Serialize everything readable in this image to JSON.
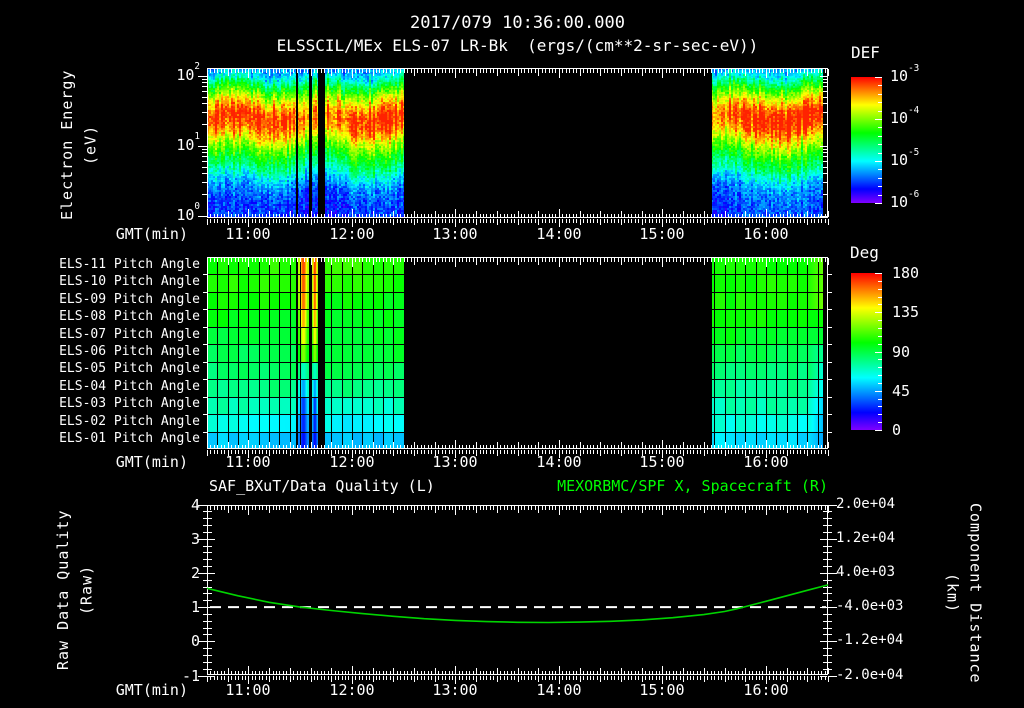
{
  "header": {
    "datetime": "2017/079 10:36:00.000",
    "title": "ELSSCIL/MEx ELS-07 LR-Bk  (ergs/(cm**2-sr-sec-eV))"
  },
  "time_axis": {
    "label": "GMT(min)",
    "start_hour": 10.6,
    "end_hour": 16.6,
    "tick_hours": [
      11,
      12,
      13,
      14,
      15,
      16
    ],
    "tick_labels": [
      "11:00",
      "12:00",
      "13:00",
      "14:00",
      "15:00",
      "16:00"
    ],
    "minor_step_min": 2,
    "medium_step_min": 12
  },
  "colors": {
    "background": "#000000",
    "foreground": "#ffffff",
    "accent_green": "#00ff00",
    "curve_green": "#00d400"
  },
  "chart_data": [
    {
      "type": "heatmap",
      "name": "electron-energy-spectrogram",
      "title": "ELSSCIL/MEx ELS-07 LR-Bk  (ergs/(cm**2-sr-sec-eV))",
      "ylabel_line1": "Electron Energy",
      "ylabel_line2": "(eV)",
      "yscale": "log",
      "ytick_exponents": [
        2,
        1,
        0
      ],
      "xlabel": "GMT(min)",
      "xlim_hours": [
        10.6,
        16.6
      ],
      "colorbar": {
        "title": "DEF",
        "scale": "log",
        "tick_exponents": [
          -3,
          -4,
          -5,
          -6
        ]
      },
      "segments_hours": [
        [
          10.61,
          12.5
        ],
        [
          15.48,
          16.55
        ]
      ],
      "gaps_hours": [
        [
          11.455,
          11.475
        ],
        [
          11.58,
          11.605
        ],
        [
          11.67,
          11.74
        ]
      ],
      "flux_profile": {
        "y_frac": [
          0,
          0.04,
          0.1,
          0.16,
          0.22,
          0.28,
          0.33,
          0.4,
          0.47,
          0.53,
          0.6,
          0.66,
          0.71,
          0.76,
          0.82,
          0.9,
          1.0
        ],
        "value": [
          0.24,
          0.28,
          0.45,
          0.62,
          0.78,
          0.9,
          0.95,
          0.9,
          0.76,
          0.64,
          0.52,
          0.44,
          0.35,
          0.27,
          0.2,
          0.16,
          0.15
        ]
      }
    },
    {
      "type": "heatmap",
      "name": "pitch-angle-panel",
      "rows": [
        "ELS-11 Pitch Angle",
        "ELS-10 Pitch Angle",
        "ELS-09 Pitch Angle",
        "ELS-08 Pitch Angle",
        "ELS-07 Pitch Angle",
        "ELS-06 Pitch Angle",
        "ELS-05 Pitch Angle",
        "ELS-04 Pitch Angle",
        "ELS-03 Pitch Angle",
        "ELS-02 Pitch Angle",
        "ELS-01 Pitch Angle"
      ],
      "row_mean_deg": [
        104,
        102,
        100,
        98,
        95,
        90,
        84,
        77,
        70,
        62,
        54
      ],
      "colorbar": {
        "title": "Deg",
        "tick_labels": [
          "180",
          "135",
          "90",
          "45",
          "0"
        ],
        "range": [
          0,
          180
        ]
      },
      "xlabel": "GMT(min)",
      "grid_step_min": 6,
      "segments_hours": [
        [
          10.61,
          12.5
        ],
        [
          15.48,
          16.55
        ]
      ],
      "gaps_hours": [
        [
          11.455,
          11.475
        ],
        [
          11.58,
          11.605
        ],
        [
          11.67,
          11.74
        ]
      ],
      "anomaly_streaks_hours": [
        [
          11.475,
          11.58
        ],
        [
          11.605,
          11.67
        ]
      ],
      "anomaly_row_deg": [
        168,
        166,
        162,
        152,
        138,
        120,
        70,
        46,
        30,
        26,
        22
      ]
    },
    {
      "type": "line",
      "name": "quality-distance-plot",
      "xlabel": "GMT(min)",
      "ylabel_left_line1": "Raw Data Quality",
      "ylabel_left_line2": "(Raw)",
      "yticks_left": [
        "4",
        "3",
        "2",
        "1",
        "0",
        "-1"
      ],
      "ylim_left": [
        -1,
        4
      ],
      "ylabel_right_line1": "Component Distance",
      "ylabel_right_line2": "(km)",
      "yticks_right": [
        "2.0e+04",
        "1.2e+04",
        "4.0e+03",
        "-4.0e+03",
        "-1.2e+04",
        "-2.0e+04"
      ],
      "ylim_right": [
        -20000,
        20000
      ],
      "series": [
        {
          "name": "SAF_BXuT/Data Quality (L)",
          "style": "dashed-white-line",
          "constant_value": 1.0
        },
        {
          "name": "MEXORBMC/SPF X, Spacecraft (R)",
          "style": "solid-green-line",
          "points_t_hours_value": [
            [
              10.6,
              1.55
            ],
            [
              10.9,
              1.33
            ],
            [
              11.2,
              1.14
            ],
            [
              11.5,
              1.0
            ],
            [
              11.8,
              0.9
            ],
            [
              12.1,
              0.81
            ],
            [
              12.4,
              0.73
            ],
            [
              12.7,
              0.66
            ],
            [
              13.0,
              0.61
            ],
            [
              13.3,
              0.575
            ],
            [
              13.6,
              0.555
            ],
            [
              13.9,
              0.55
            ],
            [
              14.2,
              0.56
            ],
            [
              14.5,
              0.585
            ],
            [
              14.8,
              0.625
            ],
            [
              15.1,
              0.69
            ],
            [
              15.4,
              0.78
            ],
            [
              15.6,
              0.87
            ],
            [
              15.72,
              0.95
            ],
            [
              15.82,
              1.03
            ],
            [
              16.0,
              1.17
            ],
            [
              16.2,
              1.33
            ],
            [
              16.4,
              1.49
            ],
            [
              16.6,
              1.65
            ]
          ]
        }
      ]
    }
  ]
}
